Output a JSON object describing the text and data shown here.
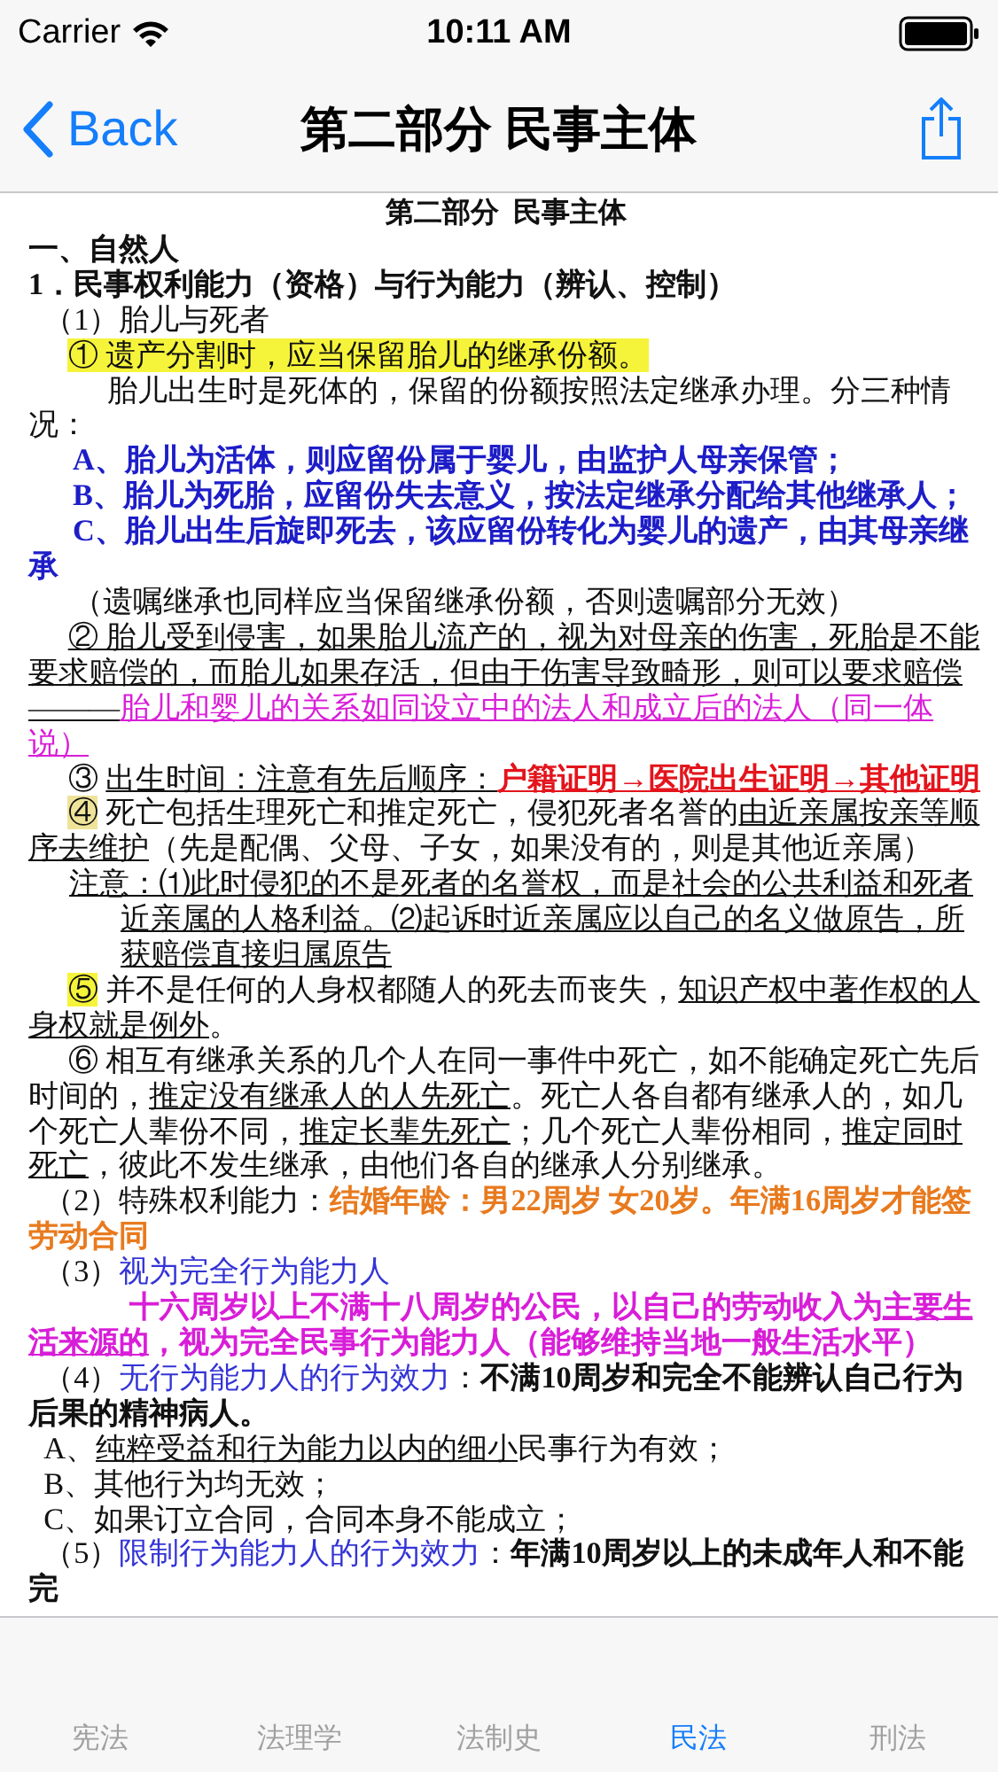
{
  "status_bar": {
    "carrier": "Carrier",
    "time": "10:11 AM"
  },
  "nav_bar": {
    "back": "Back",
    "title": "第二部分 民事主体"
  },
  "document": {
    "paragraphs": [
      {
        "kind": "title",
        "runs": [
          {
            "kind": "plain",
            "text": "第二部分  民事主体"
          }
        ]
      },
      {
        "kind": "heading",
        "runs": [
          {
            "kind": "plain",
            "text": "一、自然人"
          }
        ]
      },
      {
        "kind": "heading",
        "runs": [
          {
            "kind": "plain",
            "text": "1．民事权利能力（资格）与行为能力（辨认、控制）"
          }
        ]
      },
      {
        "kind": "item",
        "runs": [
          {
            "kind": "plain",
            "text": "（1）胎儿与死者"
          }
        ]
      },
      {
        "kind": "point",
        "runs": [
          {
            "kind": "highlight",
            "text": "① 遗产分割时，应当保留胎儿的继承份额。"
          }
        ]
      },
      {
        "kind": "body",
        "runs": [
          {
            "kind": "plain",
            "text": "胎儿出生时是死体的，保留的份额按照法定继承办理。分三种情况："
          }
        ]
      },
      {
        "kind": "sub",
        "runs": [
          {
            "kind": "blue-bold",
            "text": "A、胎儿为活体，则应留份属于婴儿，由监护人母亲保管；"
          }
        ]
      },
      {
        "kind": "sub",
        "runs": [
          {
            "kind": "blue-bold",
            "text": "B、胎儿为死胎，应留份失去意义，按法定继承分配给其他继承人；"
          }
        ]
      },
      {
        "kind": "sub",
        "runs": [
          {
            "kind": "blue-bold",
            "text": "C、胎儿出生后旋即死去，该应留份转化为婴儿的遗产，由其母亲继承"
          }
        ]
      },
      {
        "kind": "sub",
        "runs": [
          {
            "kind": "plain",
            "text": "（遗嘱继承也同样应当保留继承份额，否则遗嘱部分无效）"
          }
        ]
      },
      {
        "kind": "point",
        "runs": [
          {
            "kind": "underline",
            "text": "② 胎儿受到侵害，如果胎儿流产的，视为对母亲的伤害，死胎是不能要求赔偿的，而胎儿如果存活，但由于伤害导致畸形，则可以要求赔偿———"
          },
          {
            "kind": "magenta-underline",
            "text": "胎儿和婴儿的关系如同设立中的法人和成立后的法人（同一体说）"
          }
        ]
      },
      {
        "kind": "point",
        "runs": [
          {
            "kind": "plain",
            "text": "③ "
          },
          {
            "kind": "underline",
            "text": "出生时间：注意有先后顺序："
          },
          {
            "kind": "red-bold-underline",
            "text": "户籍证明→医院出生证明→其他证明"
          }
        ]
      },
      {
        "kind": "point",
        "runs": [
          {
            "kind": "soft-highlight",
            "text": "④"
          },
          {
            "kind": "plain",
            "text": " 死亡包括生理死亡和推定死亡，侵犯死者名誉的"
          },
          {
            "kind": "underline",
            "text": "由近亲属按亲等顺序去维护"
          },
          {
            "kind": "plain",
            "text": "（先是配偶、父母、子女，如果没有的，则是其他近亲属）"
          }
        ]
      },
      {
        "kind": "note",
        "runs": [
          {
            "kind": "underline",
            "text": "注意：⑴此时侵犯的不是死者的名誉权，而是社会的公共利益和死者近亲属的人格利益。⑵起诉时近亲属应以自己的名义做原告，所获赔偿直接归属原告"
          }
        ]
      },
      {
        "kind": "point",
        "runs": [
          {
            "kind": "highlight",
            "text": "⑤"
          },
          {
            "kind": "plain",
            "text": " 并不是任何的人身权都随人的死去而丧失，"
          },
          {
            "kind": "underline",
            "text": "知识产权中著作权的人身权就是例外"
          },
          {
            "kind": "plain",
            "text": "。"
          }
        ]
      },
      {
        "kind": "point",
        "runs": [
          {
            "kind": "plain",
            "text": "⑥ 相互有继承关系的几个人在同一事件中死亡，如不能确定死亡先后时间的，"
          },
          {
            "kind": "underline",
            "text": "推定没有继承人的人先死亡"
          },
          {
            "kind": "plain",
            "text": "。死亡人各自都有继承人的，如几个死亡人辈份不同，"
          },
          {
            "kind": "underline",
            "text": "推定长辈先死亡"
          },
          {
            "kind": "plain",
            "text": "；几个死亡人辈份相同，"
          },
          {
            "kind": "underline",
            "text": "推定同时死亡"
          },
          {
            "kind": "plain",
            "text": "，彼此不发生继承，由他们各自的继承人分别继承。"
          }
        ]
      },
      {
        "kind": "item",
        "runs": [
          {
            "kind": "plain",
            "text": "（2）特殊权利能力："
          },
          {
            "kind": "orange-bold",
            "text": "结婚年龄：男22周岁 女20岁。年满16周岁才能签劳动合同"
          }
        ]
      },
      {
        "kind": "item",
        "runs": [
          {
            "kind": "plain",
            "text": "（3）"
          },
          {
            "kind": "blue",
            "text": "视为完全行为能力人"
          }
        ]
      },
      {
        "kind": "quote",
        "runs": [
          {
            "kind": "magenta-bold",
            "text": "十六周岁以上不满十八周岁的公民，以自己的劳动收入为"
          },
          {
            "kind": "magenta-bold-underline",
            "text": "主要生活来源的"
          },
          {
            "kind": "magenta-bold",
            "text": "，视为完全民事行为能力人（能够维持当地一般生活水平）"
          }
        ]
      },
      {
        "kind": "item",
        "runs": [
          {
            "kind": "plain",
            "text": "（4）"
          },
          {
            "kind": "blue",
            "text": "无行为能力人的行为效力"
          },
          {
            "kind": "plain",
            "text": "："
          },
          {
            "kind": "bold",
            "text": "不满10周岁和完全不能辨认自己行为后果的精神病人。"
          }
        ]
      },
      {
        "kind": "item",
        "runs": [
          {
            "kind": "plain",
            "text": "A、"
          },
          {
            "kind": "underline",
            "text": "纯粹受益和行为能力以内的细小"
          },
          {
            "kind": "plain",
            "text": "民事行为有效；"
          }
        ]
      },
      {
        "kind": "item",
        "runs": [
          {
            "kind": "plain",
            "text": "B、其他行为均无效；"
          }
        ]
      },
      {
        "kind": "item",
        "runs": [
          {
            "kind": "plain",
            "text": "C、如果订立合同，合同本身不能成立；"
          }
        ]
      },
      {
        "kind": "item",
        "runs": [
          {
            "kind": "plain",
            "text": "（5）"
          },
          {
            "kind": "blue",
            "text": "限制行为能力人的行为效力"
          },
          {
            "kind": "plain",
            "text": "："
          },
          {
            "kind": "bold",
            "text": "年满10周岁以上的未成年人和不能完"
          }
        ]
      }
    ]
  },
  "tab_bar": {
    "tabs": [
      {
        "label": "宪法",
        "selected": false
      },
      {
        "label": "法理学",
        "selected": false
      },
      {
        "label": "法制史",
        "selected": false
      },
      {
        "label": "民法",
        "selected": true
      },
      {
        "label": "刑法",
        "selected": false
      }
    ]
  }
}
